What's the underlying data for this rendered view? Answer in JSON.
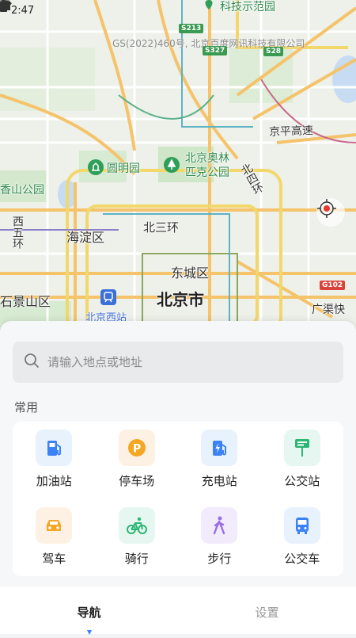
{
  "status_bar": {
    "time": "2:47"
  },
  "map": {
    "copyright": "GS(2022)460号, 北京百度网讯科技有限公司",
    "labels": {
      "keji_park": "科技示范园",
      "yuanmingyuan": "圆明园",
      "olympic_line1": "北京奥林",
      "olympic_line2": "匹克公园",
      "xiangshan": "香山公园",
      "haidian": "海淀区",
      "north3rd": "北三环",
      "dongcheng": "东城区",
      "beijing": "北京市",
      "shijingshan": "石景山区",
      "beijing_west": "北京西站",
      "jingping": "京平高速",
      "north4th": "北四环",
      "west5th": "西五环",
      "guangqu": "广渠快"
    },
    "road_badges": {
      "s213": "S213",
      "s327": "S327",
      "s28": "S28",
      "g102": "G102"
    }
  },
  "search": {
    "placeholder": "请输入地点或地址"
  },
  "section": {
    "common_title": "常用"
  },
  "shortcuts": [
    {
      "label": "加油站",
      "icon": "gas-station-icon"
    },
    {
      "label": "停车场",
      "icon": "parking-icon"
    },
    {
      "label": "充电站",
      "icon": "charging-station-icon"
    },
    {
      "label": "公交站",
      "icon": "bus-stop-icon"
    },
    {
      "label": "驾车",
      "icon": "car-icon"
    },
    {
      "label": "骑行",
      "icon": "bicycle-icon"
    },
    {
      "label": "步行",
      "icon": "walking-icon"
    },
    {
      "label": "公交车",
      "icon": "bus-icon"
    }
  ],
  "tabs": {
    "navigation": "导航",
    "settings": "设置"
  },
  "colors": {
    "accent_blue": "#3b82f6",
    "orange": "#f5a623",
    "green": "#2bb673",
    "purple": "#9b6fe3"
  }
}
